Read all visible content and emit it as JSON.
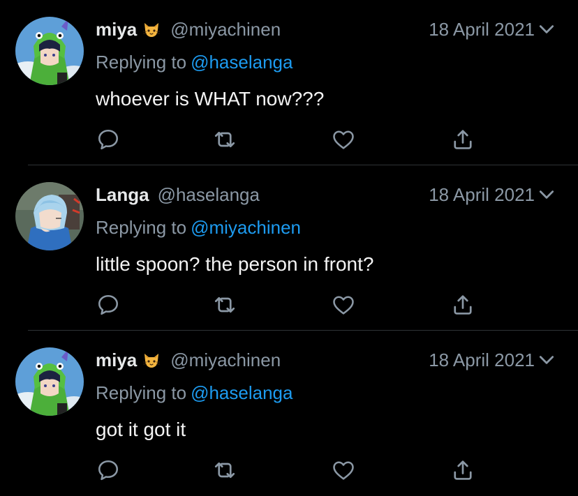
{
  "colors": {
    "background": "#000000",
    "text": "#e7e9ea",
    "secondary": "#8b98a5",
    "link": "#1d9bf0",
    "divider": "#2f3336"
  },
  "tweets": [
    {
      "display_name": "miya",
      "emoji_icon": "cat-face-icon",
      "handle": "@miyachinen",
      "date": "18 April 2021",
      "replying_label": "Replying to",
      "replying_to": "@haselanga",
      "text": "whoever is WHAT now???",
      "avatar": "avatar-miya"
    },
    {
      "display_name": "Langa",
      "handle": "@haselanga",
      "date": "18 April 2021",
      "replying_label": "Replying to",
      "replying_to": "@miyachinen",
      "text": "little spoon? the person in front?",
      "avatar": "avatar-langa"
    },
    {
      "display_name": "miya",
      "emoji_icon": "cat-face-icon",
      "handle": "@miyachinen",
      "date": "18 April 2021",
      "replying_label": "Replying to",
      "replying_to": "@haselanga",
      "text": "got it got it",
      "avatar": "avatar-miya"
    }
  ],
  "action_icons": [
    "reply-icon",
    "retweet-icon",
    "like-icon",
    "share-icon"
  ]
}
